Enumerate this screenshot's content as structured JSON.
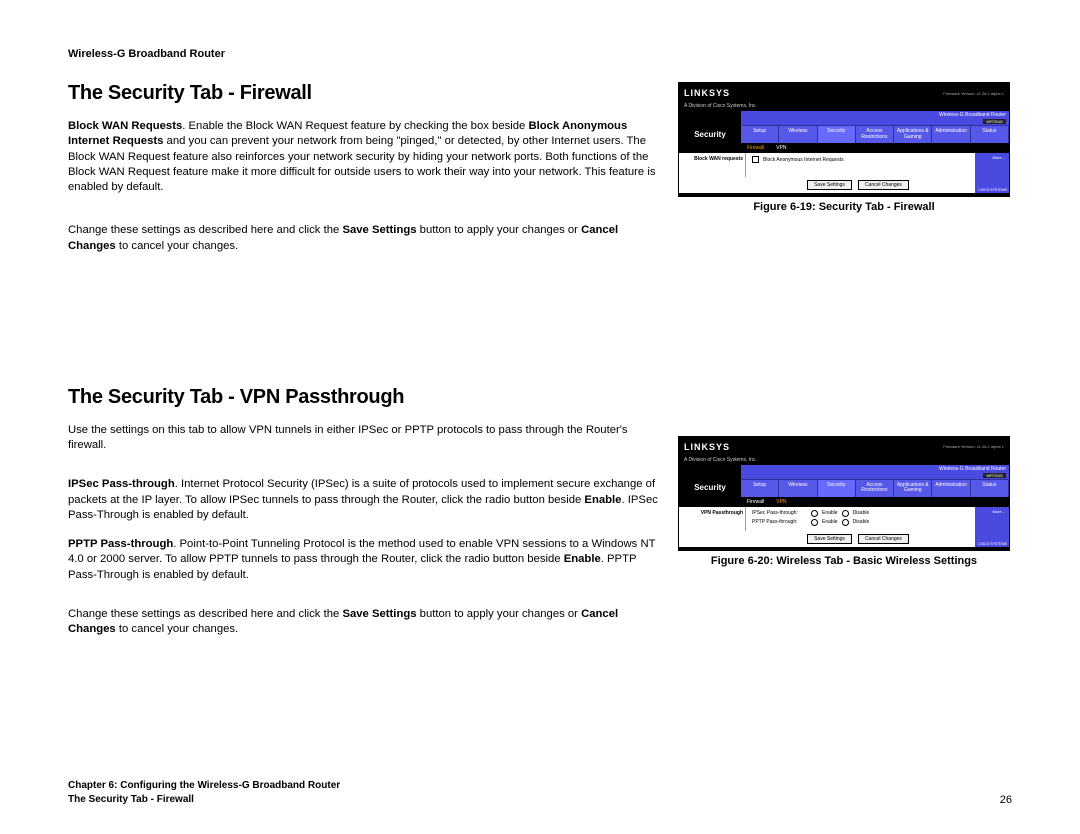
{
  "doc": {
    "product": "Wireless-G Broadband Router",
    "page_number": "26",
    "footer_chapter": "Chapter 6: Configuring the Wireless-G Broadband Router",
    "footer_section": "The Security Tab - Firewall"
  },
  "section1": {
    "heading": "The Security Tab - Firewall",
    "p1_b1": "Block WAN Requests",
    "p1_t1": ". Enable the Block WAN Request feature by checking the box beside ",
    "p1_b2": "Block Anonymous Internet Requests",
    "p1_t2": " and you can prevent your network from being \"pinged,\" or detected, by other Internet users. The Block WAN Request feature also reinforces your network security by hiding your network ports. Both functions of the Block WAN Request feature make it more difficult for outside users to work their way into your network. This feature is enabled by default.",
    "p2_t1": "Change these settings as described here and click the ",
    "p2_b1": "Save Settings",
    "p2_t2": " button to apply your changes or ",
    "p2_b2": "Cancel Changes",
    "p2_t3": " to cancel your changes."
  },
  "section2": {
    "heading": "The Security Tab - VPN Passthrough",
    "p1": "Use the settings on this tab to allow VPN tunnels in either IPSec or PPTP protocols to pass through the Router's firewall.",
    "p2_b1": "IPSec Pass-through",
    "p2_t1": ". Internet Protocol Security (IPSec) is a suite of protocols used to implement secure exchange of packets at the IP layer. To allow IPSec tunnels to pass through the Router, click the radio button beside ",
    "p2_b2": "Enable",
    "p2_t2": ". IPSec Pass-Through is enabled by default.",
    "p3_b1": "PPTP Pass-through",
    "p3_t1": ". Point-to-Point Tunneling Protocol is the method used to enable VPN sessions to a Windows NT 4.0 or 2000 server. To allow PPTP tunnels to pass through the Router, click the radio button beside ",
    "p3_b2": "Enable",
    "p3_t2": ". PPTP Pass-Through is enabled by default.",
    "p4_t1": "Change these settings as described here and click the ",
    "p4_b1": "Save Settings",
    "p4_t2": " button to apply your changes or ",
    "p4_b2": "Cancel Changes",
    "p4_t3": " to cancel your changes."
  },
  "fig1": {
    "caption": "Figure 6-19: Security Tab - Firewall",
    "logo": "LINKSYS",
    "subtitle": "A Division of Cisco Systems, Inc.",
    "fw": "Firmware Version: v1.28.1 alpha 1",
    "bar_title": "Wireless-G Broadband Router",
    "model": "WRT54G",
    "cat": "Security",
    "tabs": [
      "Setup",
      "Wireless",
      "Security",
      "Access Restrictions",
      "Applications & Gaming",
      "Administration",
      "Status"
    ],
    "subtabs": [
      "Firewall",
      "VPN"
    ],
    "side_label": "Block WAN requests",
    "opt1": "Block Anonymous Internet Requests",
    "btn_save": "Save Settings",
    "btn_cancel": "Cancel Changes",
    "more": "More...",
    "cisco": "CISCO SYSTEMS"
  },
  "fig2": {
    "caption": "Figure 6-20: Wireless Tab - Basic Wireless Settings",
    "logo": "LINKSYS",
    "subtitle": "A Division of Cisco Systems, Inc.",
    "fw": "Firmware Version: v1.28.1 alpha 1",
    "bar_title": "Wireless-G Broadband Router",
    "model": "WRT54G",
    "cat": "Security",
    "tabs": [
      "Setup",
      "Wireless",
      "Security",
      "Access Restrictions",
      "Applications & Gaming",
      "Administration",
      "Status"
    ],
    "subtabs": [
      "Firewall",
      "VPN"
    ],
    "side_label": "VPN Passthrough",
    "row1_label": "IPSec Pass-through:",
    "row2_label": "PPTP Pass-through:",
    "enable": "Enable",
    "disable": "Disable",
    "btn_save": "Save Settings",
    "btn_cancel": "Cancel Changes",
    "more": "More...",
    "cisco": "CISCO SYSTEMS"
  }
}
